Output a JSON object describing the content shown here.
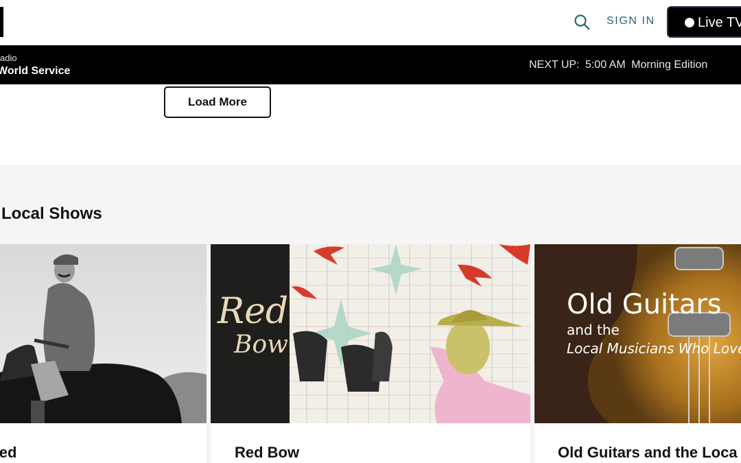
{
  "header": {
    "sign_in_label": "SIGN IN",
    "live_tv_label": "Live TV",
    "accent_color": "#2b6670"
  },
  "player": {
    "station": "adio",
    "program": "World Service",
    "next_up_label": "NEXT UP:",
    "next_up_time": "5:00 AM",
    "next_up_show": "Morning Edition"
  },
  "load_more_label": "Load More",
  "shows": {
    "section_title": "e Local Shows",
    "cards": [
      {
        "title": "nted"
      },
      {
        "title": "Red Bow",
        "art_line1": "Red",
        "art_line2": "Bow"
      },
      {
        "title": "Old Guitars and the Loca",
        "art_title": "Old Guitars",
        "art_line1": "and the",
        "art_line2": "Local Musicians Who Love"
      }
    ]
  }
}
